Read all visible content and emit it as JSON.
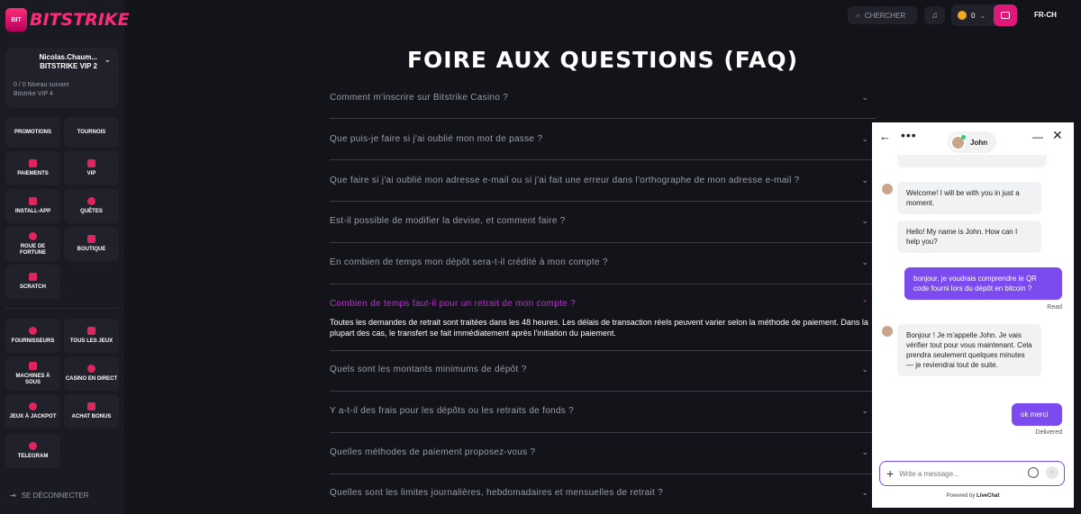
{
  "brand": {
    "badge": "BIT",
    "name": "BITSTRIKE"
  },
  "user": {
    "name": "Nicolas.Chaum...",
    "vip": "BITSTRIKE VIP 2",
    "progress": "0 / 0 Niveau suivant",
    "next_level": "Bitstrike VIP 4"
  },
  "menu_top": [
    {
      "label": "PROMOTIONS"
    },
    {
      "label": "TOURNOIS"
    },
    {
      "label": "PAIEMENTS"
    },
    {
      "label": "VIP"
    },
    {
      "label": "INSTALL-APP"
    },
    {
      "label": "QUÊTES"
    },
    {
      "label": "ROUE DE FORTUNE"
    },
    {
      "label": "BOUTIQUE"
    },
    {
      "label": "SCRATCH"
    }
  ],
  "menu_games": [
    {
      "label": "FOURNISSEURS"
    },
    {
      "label": "TOUS LES JEUX"
    },
    {
      "label": "MACHINES À SOUS"
    },
    {
      "label": "CASINO EN DIRECT"
    },
    {
      "label": "JEUX À JACKPOT"
    },
    {
      "label": "ACHAT BONUS"
    },
    {
      "label": "TELEGRAM"
    }
  ],
  "logout": "SE DÉCONNECTER",
  "topbar": {
    "search": "CHERCHER",
    "balance": "0",
    "lang": "FR-CH"
  },
  "faq": {
    "title": "FOIRE AUX QUESTIONS (FAQ)",
    "items": [
      {
        "q": "Comment m'inscrire sur Bitstrike Casino ?"
      },
      {
        "q": "Que puis-je faire si j'ai oublié mon mot de passe ?"
      },
      {
        "q": "Que faire si j'ai oublié mon adresse e-mail ou si j'ai fait une erreur dans l'orthographe de mon adresse e-mail ?"
      },
      {
        "q": "Est-il possible de modifier la devise, et comment faire ?"
      },
      {
        "q": "En combien de temps mon dépôt sera-t-il crédité à mon compte ?"
      },
      {
        "q": "Combien de temps faut-il pour un retrait de mon compte ?",
        "a": "Toutes les demandes de retrait sont traitées dans les 48 heures. Les délais de transaction réels peuvent varier selon la méthode de paiement. Dans la plupart des cas, le transfert se fait immédiatement après l'initiation du paiement."
      },
      {
        "q": "Quels sont les montants minimums de dépôt ?"
      },
      {
        "q": "Y a-t-il des frais pour les dépôts ou les retraits de fonds ?"
      },
      {
        "q": "Quelles méthodes de paiement proposez-vous ?"
      },
      {
        "q": "Quelles sont les limites journalières, hebdomadaires et mensuelles de retrait ?"
      }
    ]
  },
  "chat": {
    "agent": "John",
    "messages": [
      {
        "from": "agent",
        "text": "Welcome! I will be with you in just a moment."
      },
      {
        "from": "agent",
        "text": "Hello! My name is John. How can I help you?"
      },
      {
        "from": "user",
        "text": "bonjour, je voudrais comprendre le QR code fourni lors du dépôt en bitcoin ?",
        "status": "Read"
      },
      {
        "from": "agent",
        "text": "Bonjour ! Je m'appelle John. Je vais vérifier tout pour vous maintenant. Cela prendra seulement quelques minutes — je reviendrai tout de suite."
      },
      {
        "from": "user",
        "text": "ok merci",
        "status": "Delivered"
      }
    ],
    "input_placeholder": "Write a message...",
    "powered_prefix": "Powered by",
    "powered_brand": "LiveChat"
  }
}
